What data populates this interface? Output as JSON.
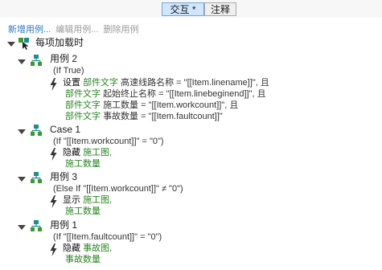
{
  "tabs": {
    "interaction": "交互 *",
    "notes": "注释"
  },
  "toolbar": {
    "new_case": "新增用例...",
    "edit_case": "编辑用例...",
    "delete_case": "删除用例"
  },
  "event": {
    "label": "每项加载时"
  },
  "case1": {
    "label": "用例 2",
    "condition": "(If True)",
    "action": "设置",
    "lines": [
      {
        "target": "部件文字",
        "text": "高速线路名称 = \"[[Item.linename]]\", 且"
      },
      {
        "target": "部件文字",
        "text": "起始终止名称 = \"[[Item.linebeginend]]\", 且"
      },
      {
        "target": "部件文字",
        "text": "施工数量 = \"[[Item.workcount]]\", 且"
      },
      {
        "target": "部件文字",
        "text": "事故数量 = \"[[Item.faultcount]]\""
      }
    ]
  },
  "case2": {
    "label": "Case 1",
    "condition": "(If \"[[Item.workcount]]\" = \"0\")",
    "action": "隐藏",
    "targets": [
      "施工图,",
      "施工数量"
    ]
  },
  "case3": {
    "label": "用例 3",
    "condition": "(Else If \"[[Item.workcount]]\" ≠ \"0\")",
    "action": "显示",
    "targets": [
      "施工图,",
      "施工数量"
    ]
  },
  "case4": {
    "label": "用例 1",
    "condition": "(If \"[[Item.faultcount]]\" = \"0\")",
    "action": "隐藏",
    "targets": [
      "事故图,",
      "事故数量"
    ]
  },
  "colors": {
    "link": "#2b78c5",
    "target_text": "#27861f",
    "active_tab": "#cfe6fb",
    "icon_green": "#3a9a2e",
    "icon_teal": "#1f8e8a"
  },
  "icons": {
    "event": "cursor-event-icon",
    "case": "case-tree-icon",
    "action": "lightning-icon",
    "expand": "expand-arrow-icon"
  }
}
